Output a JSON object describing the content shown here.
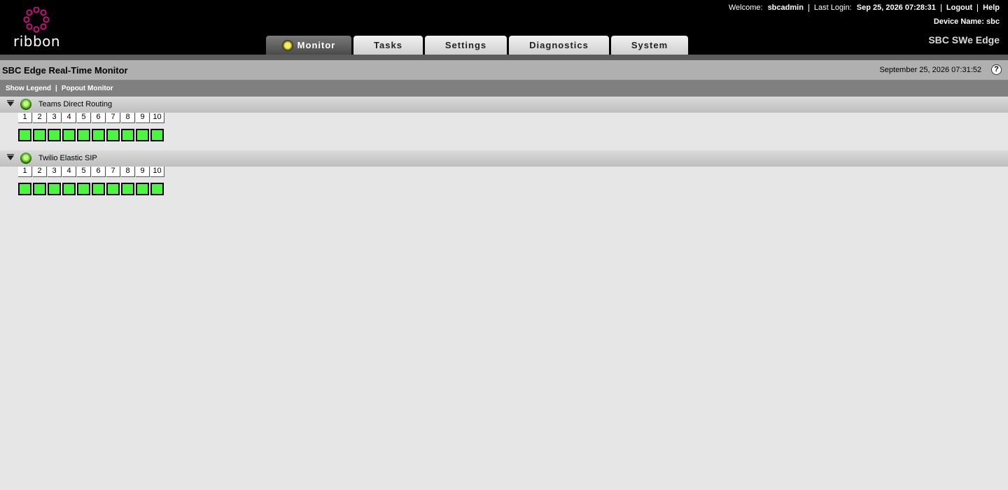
{
  "header": {
    "logo_text": "ribbon",
    "welcome_label": "Welcome:",
    "username": "sbcadmin",
    "last_login_label": "Last Login:",
    "last_login_value": "Sep 25, 2026 07:28:31",
    "logout": "Logout",
    "help": "Help",
    "device_name_label": "Device Name:",
    "device_name": "sbc",
    "product": "SBC SWe Edge"
  },
  "tabs": [
    {
      "label": "Monitor",
      "active": true
    },
    {
      "label": "Tasks"
    },
    {
      "label": "Settings"
    },
    {
      "label": "Diagnostics"
    },
    {
      "label": "System"
    }
  ],
  "titlebar": {
    "title": "SBC Edge Real-Time Monitor",
    "datetime": "September 25, 2026 07:31:52"
  },
  "actions": {
    "show_legend": "Show Legend",
    "separator": "|",
    "popout_monitor": "Popout Monitor"
  },
  "groups": [
    {
      "name": "Teams Direct Routing",
      "status": "ok",
      "channels": [
        "1",
        "2",
        "3",
        "4",
        "5",
        "6",
        "7",
        "8",
        "9",
        "10"
      ],
      "channel_color": "#4cf53f"
    },
    {
      "name": "Twilio Elastic SIP",
      "status": "ok",
      "channels": [
        "1",
        "2",
        "3",
        "4",
        "5",
        "6",
        "7",
        "8",
        "9",
        "10"
      ],
      "channel_color": "#4cf53f"
    }
  ],
  "colors": {
    "header_bg": "#000000",
    "logo_accent": "#c5127f",
    "channel_idle": "#4cf53f",
    "page_bg": "#e6e6e6"
  }
}
